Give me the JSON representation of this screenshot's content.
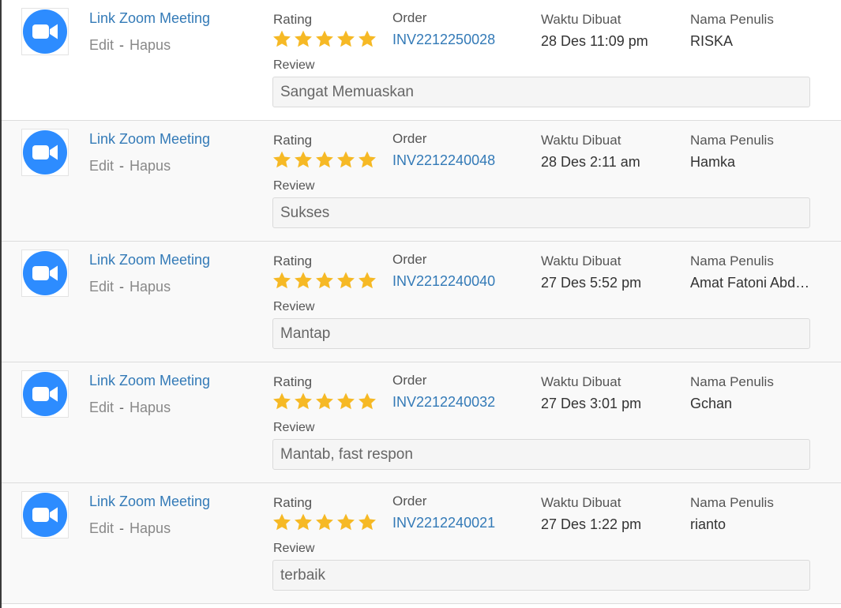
{
  "colors": {
    "accent": "#337ab7",
    "star": "#f6b925",
    "zoom_blue": "#2d8cff"
  },
  "labels": {
    "rating": "Rating",
    "order": "Order",
    "waktu": "Waktu Dibuat",
    "penulis": "Nama Penulis",
    "review": "Review",
    "edit": "Edit",
    "separator": "-",
    "hapus": "Hapus"
  },
  "reviews": [
    {
      "product": "Link Zoom Meeting",
      "icon": "zoom-icon",
      "rating": 5,
      "order": "INV2212250028",
      "waktu": "28 Des 11:09 pm",
      "penulis": "RISKA",
      "review": "Sangat Memuaskan"
    },
    {
      "product": "Link Zoom Meeting",
      "icon": "zoom-icon",
      "rating": 5,
      "order": "INV2212240048",
      "waktu": "28 Des 2:11 am",
      "penulis": "Hamka",
      "review": "Sukses"
    },
    {
      "product": "Link Zoom Meeting",
      "icon": "zoom-icon",
      "rating": 5,
      "order": "INV2212240040",
      "waktu": "27 Des 5:52 pm",
      "penulis": "Amat Fatoni Abd…",
      "review": "Mantap"
    },
    {
      "product": "Link Zoom Meeting",
      "icon": "zoom-icon",
      "rating": 5,
      "order": "INV2212240032",
      "waktu": "27 Des 3:01 pm",
      "penulis": "Gchan",
      "review": "Mantab, fast respon"
    },
    {
      "product": "Link Zoom Meeting",
      "icon": "zoom-icon",
      "rating": 5,
      "order": "INV2212240021",
      "waktu": "27 Des 1:22 pm",
      "penulis": "rianto",
      "review": "terbaik"
    }
  ]
}
